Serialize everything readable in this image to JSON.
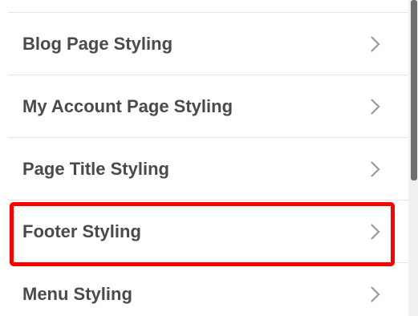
{
  "menu": {
    "items": [
      {
        "label": "Blog Page Styling"
      },
      {
        "label": "My Account Page Styling"
      },
      {
        "label": "Page Title Styling"
      },
      {
        "label": "Footer Styling"
      },
      {
        "label": "Menu Styling"
      }
    ]
  },
  "colors": {
    "text": "#4a4a4a",
    "divider": "#e6e6e6",
    "highlight": "#ff0000",
    "chevron": "#9a9a9a",
    "scroll_thumb": "#6f6f6f"
  },
  "icons": {
    "chevron": "chevron-right-icon"
  }
}
